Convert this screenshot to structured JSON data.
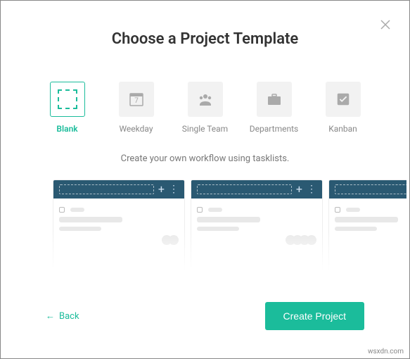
{
  "modal": {
    "title": "Choose a Project Template",
    "description": "Create your own workflow using tasklists."
  },
  "templates": {
    "items": [
      {
        "name": "Blank",
        "icon": "blank-icon"
      },
      {
        "name": "Weekday",
        "icon": "calendar-icon"
      },
      {
        "name": "Single Team",
        "icon": "team-icon"
      },
      {
        "name": "Departments",
        "icon": "briefcase-icon"
      },
      {
        "name": "Kanban",
        "icon": "checkbox-icon"
      }
    ],
    "selected": 0
  },
  "footer": {
    "back_label": "Back",
    "create_label": "Create Project"
  },
  "colors": {
    "accent": "#1bbc9b",
    "header": "#2a5972"
  },
  "watermark": "wsxdn.com"
}
